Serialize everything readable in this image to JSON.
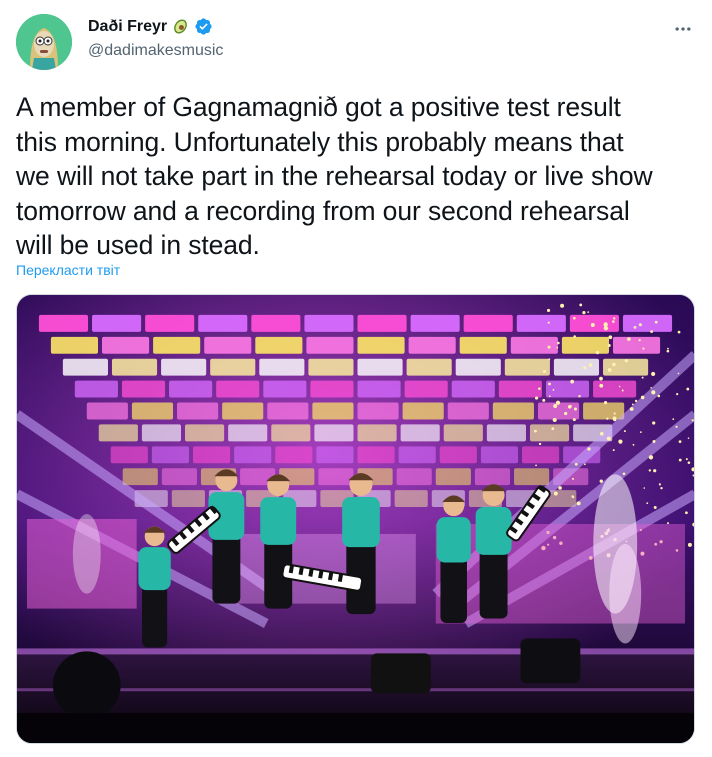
{
  "author": {
    "display_name": "Daði Freyr",
    "handle": "@dadimakesmusic",
    "verified": true,
    "name_emoji": "avocado-icon",
    "avatar_icon": "avatar"
  },
  "tweet": {
    "text": "A member of Gagnamagnið got a positive test result\nthis morning. Unfortunately this probably means that\nwe will not take part in the rehearsal today or live show\ntomorrow and a recording from our second rehearsal\nwill be used in stead.",
    "translate_label": "Перекласти твіт"
  },
  "media": {
    "kind": "photo",
    "subject": "stage-performance"
  },
  "colors": {
    "accent": "#1d9bf0",
    "secondary_text": "#536471",
    "verified": "#1d9bf0",
    "avatar_bg": "#4fc58f"
  },
  "icons": {
    "more": "more-icon",
    "verified": "verified-icon"
  }
}
